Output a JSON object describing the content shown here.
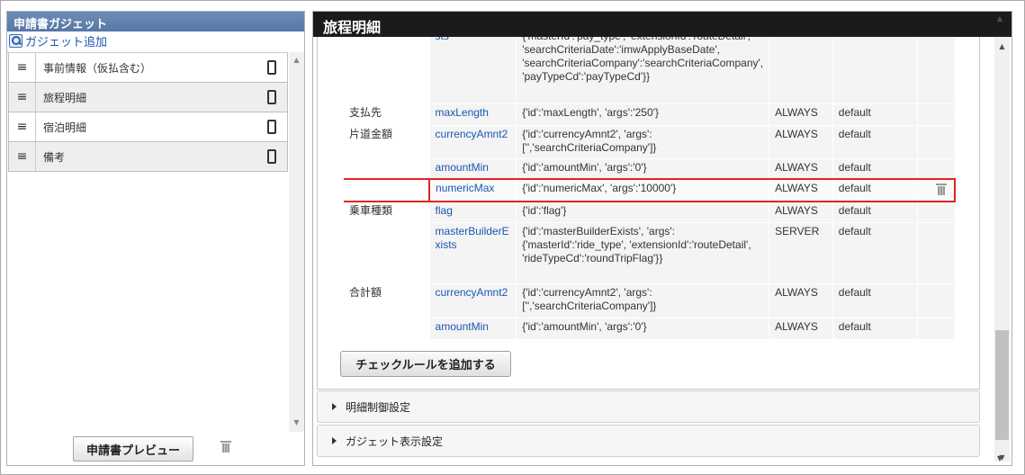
{
  "left_panel": {
    "title": "申請書ガジェット",
    "add_gadget_label": "ガジェット追加",
    "items": [
      {
        "label": "事前情報（仮払含む）"
      },
      {
        "label": "旅程明細"
      },
      {
        "label": "宿泊明細"
      },
      {
        "label": "備考"
      }
    ],
    "list_icon": "≡",
    "preview_button": "申請書プレビュー"
  },
  "right_panel": {
    "title": "旅程明細",
    "rules": [
      {
        "item": "",
        "rule": "sts",
        "args": "{'masterId':'pay_type', 'extensionId':'routeDetail', 'searchCriteriaDate':'imwApplyBaseDate', 'searchCriteriaCompany':'searchCriteriaCompany', 'payTypeCd':'payTypeCd'}}",
        "when": "",
        "type": ""
      },
      {
        "item": "支払先",
        "rule": "maxLength",
        "args": "{'id':'maxLength', 'args':'250'}",
        "when": "ALWAYS",
        "type": "default"
      },
      {
        "item": "片道金額",
        "rule": "currencyAmnt2",
        "args": "{'id':'currencyAmnt2', 'args': ['','searchCriteriaCompany']}",
        "when": "ALWAYS",
        "type": "default"
      },
      {
        "item": "",
        "rule": "amountMin",
        "args": "{'id':'amountMin', 'args':'0'}",
        "when": "ALWAYS",
        "type": "default"
      },
      {
        "item": "",
        "rule": "numericMax",
        "args": "{'id':'numericMax', 'args':'10000'}",
        "when": "ALWAYS",
        "type": "default"
      },
      {
        "item": "乗車種類",
        "rule": "flag",
        "args": "{'id':'flag'}",
        "when": "ALWAYS",
        "type": "default"
      },
      {
        "item": "",
        "rule": "masterBuilderExists",
        "args": "{'id':'masterBuilderExists', 'args': {'masterId':'ride_type', 'extensionId':'routeDetail', 'rideTypeCd':'roundTripFlag'}}",
        "when": "SERVER",
        "type": "default"
      },
      {
        "item": "合計額",
        "rule": "currencyAmnt2",
        "args": "{'id':'currencyAmnt2', 'args': ['','searchCriteriaCompany']}",
        "when": "ALWAYS",
        "type": "default"
      },
      {
        "item": "",
        "rule": "amountMin",
        "args": "{'id':'amountMin', 'args':'0'}",
        "when": "ALWAYS",
        "type": "default"
      }
    ],
    "add_rule_button": "チェックルールを追加する",
    "accordion": [
      {
        "label": "明細制御設定"
      },
      {
        "label": "ガジェット表示設定"
      }
    ]
  },
  "colors": {
    "left_header": "#6f8db7",
    "right_header": "#1b1b1b",
    "link": "#1a56b0",
    "highlight_border": "#e02424"
  },
  "icons": [
    "magnifier-icon",
    "list-icon",
    "smartphone-icon",
    "trash-icon",
    "chevron-right-icon"
  ]
}
